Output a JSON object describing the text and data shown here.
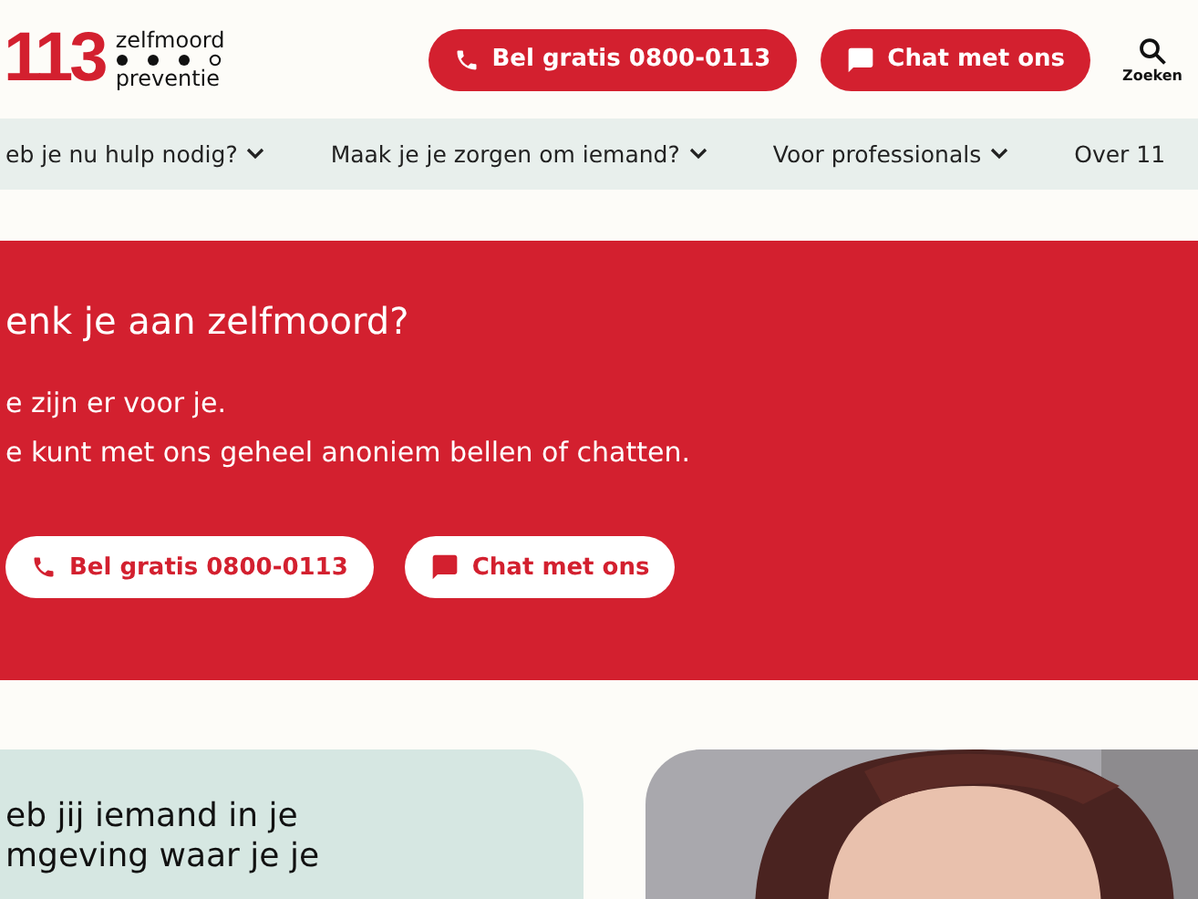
{
  "header": {
    "logo": {
      "number": "113",
      "line_1": "zelfmoord",
      "line_2": "preventie"
    },
    "buttons": [
      {
        "kind": "phone",
        "label": "Bel gratis 0800-0113"
      },
      {
        "kind": "chat",
        "label": "Chat met ons"
      }
    ],
    "search": {
      "label": "Zoeken"
    }
  },
  "nav": [
    {
      "label": "eb je nu hulp nodig?",
      "has_menu": true
    },
    {
      "label": "Maak je je zorgen om iemand?",
      "has_menu": true
    },
    {
      "label": "Voor professionals",
      "has_menu": true
    },
    {
      "label": "Over 11",
      "has_menu": false
    }
  ],
  "banner": {
    "title": "enk je aan zelfmoord?",
    "lines": [
      "e zijn er voor je.",
      "e kunt met ons geheel anoniem bellen of chatten."
    ],
    "buttons": [
      {
        "kind": "phone",
        "label": "Bel gratis 0800-0113"
      },
      {
        "kind": "chat",
        "label": "Chat met ons"
      }
    ]
  },
  "card": {
    "heading_lines": [
      "eb jij iemand in je",
      "mgeving waar je je"
    ]
  }
}
